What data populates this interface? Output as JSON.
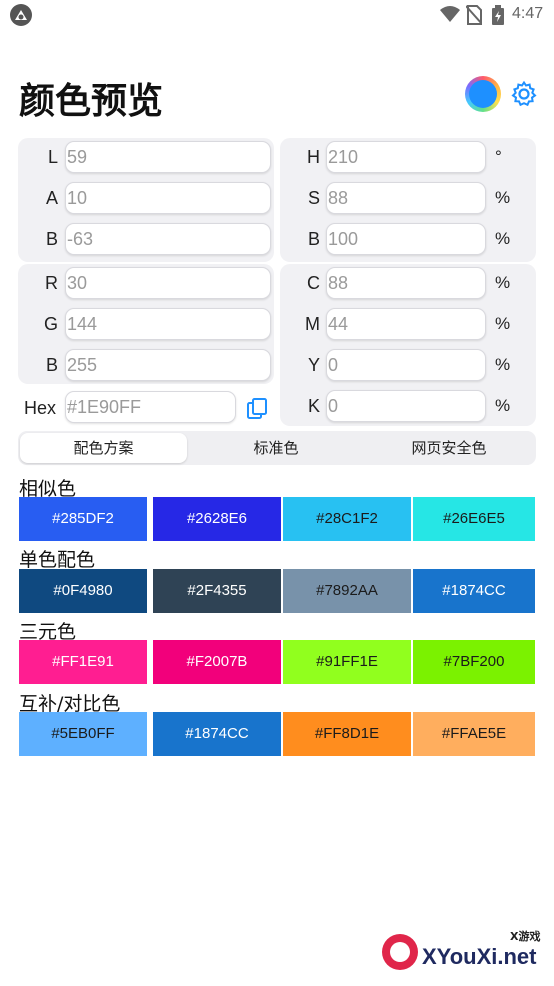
{
  "status_bar": {
    "time": "4:47",
    "icons": [
      "app-logo-icon",
      "wifi-icon",
      "no-sim-icon",
      "battery-icon"
    ]
  },
  "header": {
    "title": "颜色预览",
    "current_color": "#1E90FF",
    "icons": [
      "color-preview-icon",
      "settings-icon"
    ]
  },
  "lab": [
    {
      "label": "L",
      "value": "59"
    },
    {
      "label": "A",
      "value": "10"
    },
    {
      "label": "B",
      "value": "-63"
    }
  ],
  "hsb": [
    {
      "label": "H",
      "value": "210",
      "unit": "°"
    },
    {
      "label": "S",
      "value": "88",
      "unit": "%"
    },
    {
      "label": "B",
      "value": "100",
      "unit": "%"
    }
  ],
  "rgb": [
    {
      "label": "R",
      "value": "30"
    },
    {
      "label": "G",
      "value": "144"
    },
    {
      "label": "B",
      "value": "255"
    }
  ],
  "cmyk": [
    {
      "label": "C",
      "value": "88",
      "unit": "%"
    },
    {
      "label": "M",
      "value": "44",
      "unit": "%"
    },
    {
      "label": "Y",
      "value": "0",
      "unit": "%"
    },
    {
      "label": "K",
      "value": "0",
      "unit": "%"
    }
  ],
  "hex": {
    "label": "Hex",
    "value": "#1E90FF",
    "copy_icon": "copy-icon"
  },
  "tabs": [
    {
      "label": "配色方案",
      "active": true
    },
    {
      "label": "标准色",
      "active": false
    },
    {
      "label": "网页安全色",
      "active": false
    }
  ],
  "schemes": [
    {
      "title": "相似色",
      "colors": [
        {
          "hex": "#285DF2",
          "bg": "#285DF2"
        },
        {
          "hex": "#2628E6",
          "bg": "#2628E6"
        },
        {
          "hex": "#28C1F2",
          "bg": "#28C1F2"
        },
        {
          "hex": "#26E6E5",
          "bg": "#26E6E5"
        }
      ]
    },
    {
      "title": "单色配色",
      "colors": [
        {
          "hex": "#0F4980",
          "bg": "#0F4980"
        },
        {
          "hex": "#2F4355",
          "bg": "#2F4355"
        },
        {
          "hex": "#7892AA",
          "bg": "#7892AA"
        },
        {
          "hex": "#1874CC",
          "bg": "#1874CC"
        }
      ]
    },
    {
      "title": "三元色",
      "colors": [
        {
          "hex": "#FF1E91",
          "bg": "#FF1E91"
        },
        {
          "hex": "#F2007B",
          "bg": "#F2007B"
        },
        {
          "hex": "#91FF1E",
          "bg": "#91FF1E"
        },
        {
          "hex": "#7BF200",
          "bg": "#7BF200"
        }
      ]
    },
    {
      "title": "互补/对比色",
      "colors": [
        {
          "hex": "#5EB0FF",
          "bg": "#5EB0FF"
        },
        {
          "hex": "#1874CC",
          "bg": "#1874CC"
        },
        {
          "hex": "#FF8D1E",
          "bg": "#FF8D1E"
        },
        {
          "hex": "#FFAE5E",
          "bg": "#FFAE5E"
        }
      ]
    }
  ],
  "watermark": {
    "tag": "X游戏",
    "text": "XYouXi.net"
  }
}
